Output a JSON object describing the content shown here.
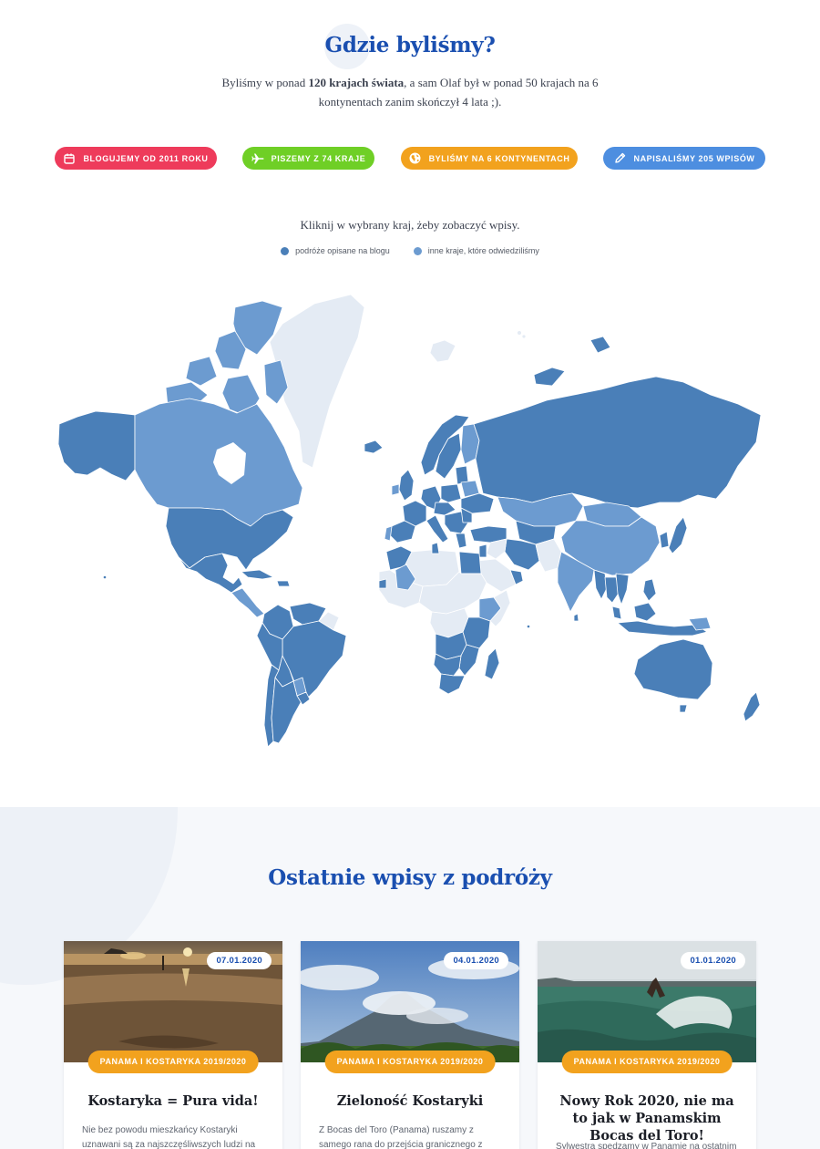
{
  "header": {
    "title": "Gdzie byliśmy?",
    "intro_pre": "Byliśmy w ponad ",
    "intro_bold": "120 krajach świata",
    "intro_post": ", a sam Olaf był w ponad 50 krajach na 6 kontynentach zanim skończył 4 lata ;)."
  },
  "badges": [
    {
      "label": "Blogujemy od 2011 roku",
      "icon": "calendar-icon",
      "color": "#ee3b5b"
    },
    {
      "label": "Piszemy z 74 kraje",
      "icon": "airplane-icon",
      "color": "#6fcf26"
    },
    {
      "label": "Byliśmy na 6 kontynentach",
      "icon": "globe-icon",
      "color": "#f2a21e"
    },
    {
      "label": "Napisaliśmy 205 wpisów",
      "icon": "pencil-icon",
      "color": "#4d8ee0"
    }
  ],
  "map": {
    "hint": "Kliknij w wybrany kraj, żeby zobaczyć wpisy.",
    "legend": [
      {
        "label": "podróże opisane na blogu",
        "color": "#4a7fb8"
      },
      {
        "label": "inne kraje, które odwiedziliśmy",
        "color": "#6c9bd0"
      }
    ],
    "colors": {
      "described": "#4a7fb8",
      "visited": "#6c9bd0",
      "unvisited": "#e4ebf4"
    }
  },
  "recent": {
    "title": "Ostatnie wpisy z podróży",
    "cards": [
      {
        "date": "07.01.2020",
        "category": "Panama i Kostaryka 2019/2020",
        "title": "Kostaryka = Pura vida!",
        "excerpt": "Nie bez powodu mieszkańcy Kostaryki uznawani są za najszczęśliwszych ludzi na świecie. To"
      },
      {
        "date": "04.01.2020",
        "category": "Panama i Kostaryka 2019/2020",
        "title": "Zieloność Kostaryki",
        "excerpt": "Z Bocas del Toro (Panama) ruszamy z samego rana do przejścia granicznego z Kostaryką."
      },
      {
        "date": "01.01.2020",
        "category": "Panama i Kostaryka 2019/2020",
        "title": "Nowy Rok 2020, nie ma to jak w Panamskim Bocas del Toro!",
        "excerpt": "Sylwestra spędzamy w Panamie na ostatnim"
      }
    ]
  }
}
